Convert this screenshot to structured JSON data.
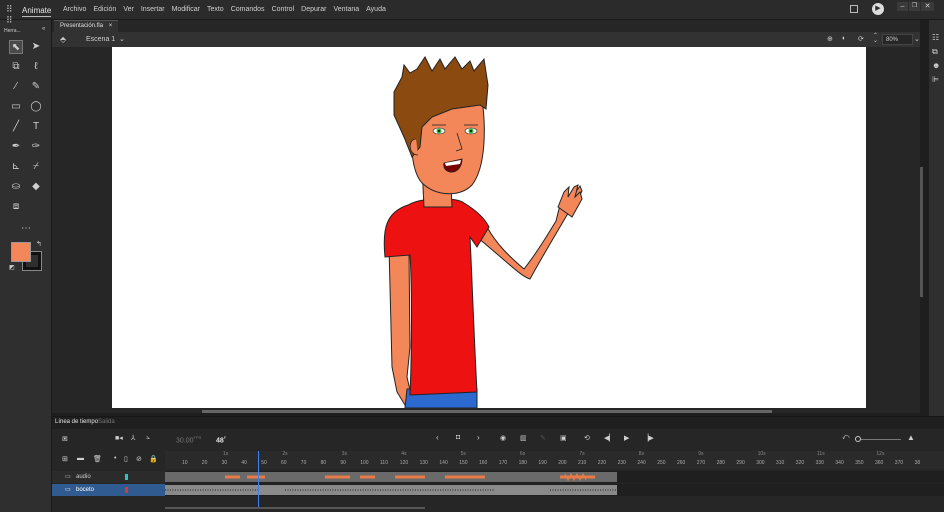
{
  "app": {
    "name": "Animate"
  },
  "menu": [
    "Archivo",
    "Edición",
    "Ver",
    "Insertar",
    "Modificar",
    "Texto",
    "Comandos",
    "Control",
    "Depurar",
    "Ventana",
    "Ayuda"
  ],
  "document": {
    "tab": "Presentación.fla"
  },
  "scene": {
    "name": "Escena 1",
    "zoom": "80%"
  },
  "tools_panel": {
    "title": "Herra..."
  },
  "colors": {
    "fill": "#f4875a",
    "stroke": "#111111"
  },
  "timeline": {
    "tabs": [
      "Línea de tiempo",
      "Salida"
    ],
    "fps": "30.00",
    "fps_unit": "FPS",
    "current_frame": "48",
    "frame_unit": "F",
    "layers": [
      {
        "name": "audio",
        "color": "#29c4c4",
        "selected": false
      },
      {
        "name": "boceto",
        "color": "#d43a3a",
        "selected": true
      }
    ],
    "frame_numbers": [
      "10",
      "20",
      "30",
      "40",
      "50",
      "60",
      "70",
      "80",
      "90",
      "100",
      "110",
      "120",
      "130",
      "140",
      "150",
      "160",
      "170",
      "180",
      "190",
      "200",
      "210",
      "220",
      "230",
      "240",
      "250",
      "260",
      "270",
      "280",
      "290",
      "300",
      "310",
      "320",
      "330",
      "340",
      "350",
      "360",
      "370",
      "38"
    ],
    "seconds": [
      "1s",
      "2s",
      "3s",
      "4s",
      "5s",
      "6s",
      "7s",
      "8s",
      "9s",
      "10s",
      "11s",
      "12s"
    ]
  }
}
